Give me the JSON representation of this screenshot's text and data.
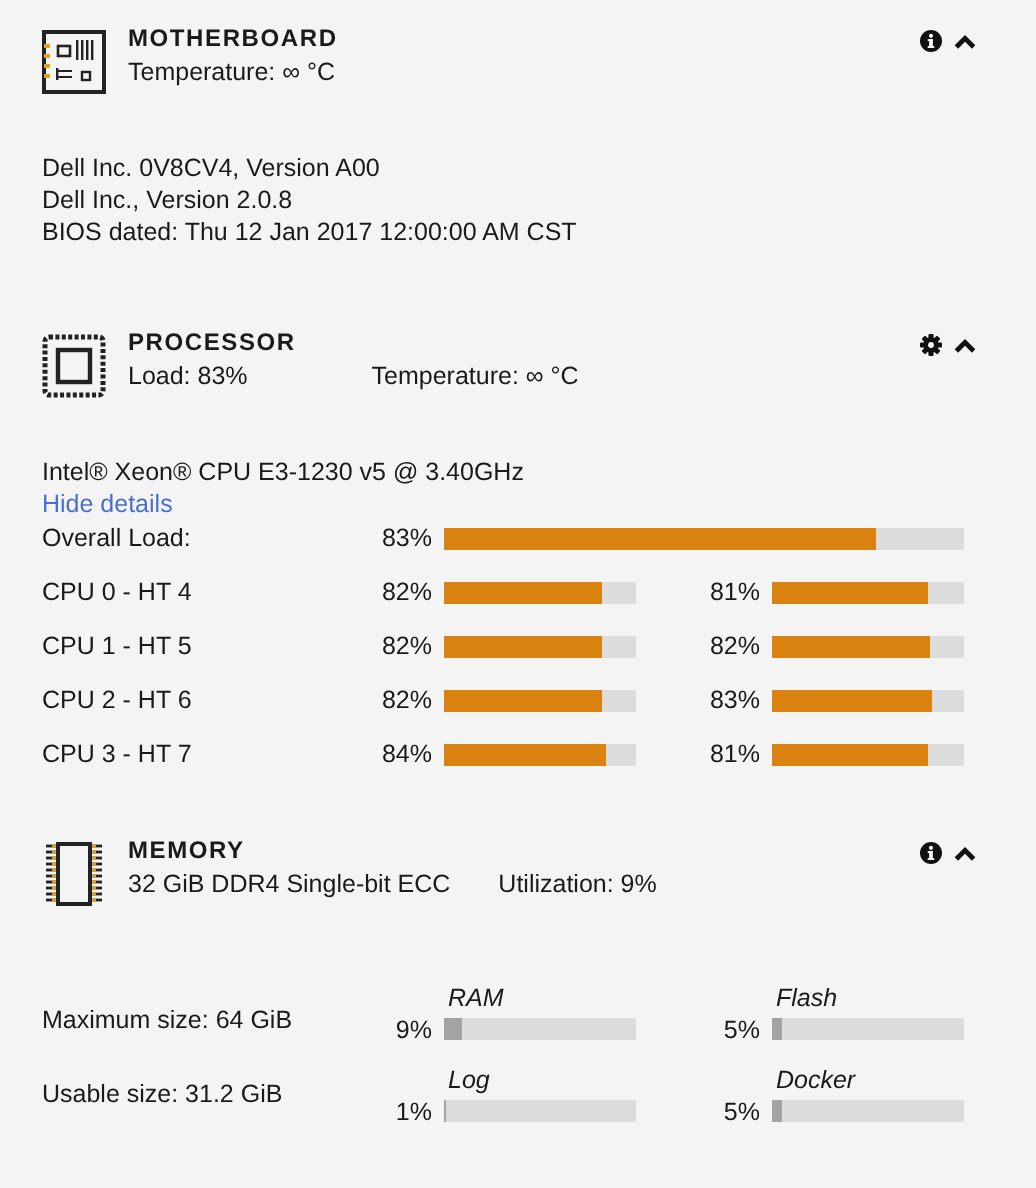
{
  "sections": [
    {
      "kind": "motherboard",
      "title": "MOTHERBOARD",
      "summary": [
        "Temperature: ∞ °C"
      ],
      "details": [
        "Dell Inc. 0V8CV4, Version A00",
        "Dell Inc., Version 2.0.8",
        "BIOS dated: Thu 12 Jan 2017 12:00:00 AM CST"
      ]
    },
    {
      "kind": "processor",
      "title": "PROCESSOR",
      "summary": [
        "Load: 83%",
        "Temperature: ∞ °C"
      ],
      "details": [
        "Intel® Xeon® CPU E3-1230 v5 @ 3.40GHz"
      ],
      "link": "Hide details",
      "overall": {
        "label": "Overall Load:",
        "reading": "83%",
        "level": 0.83
      },
      "cores": [
        {
          "label": "CPU 0 - HT 4",
          "threads": [
            {
              "reading": "82%",
              "level": 0.82
            },
            {
              "reading": "81%",
              "level": 0.81
            }
          ]
        },
        {
          "label": "CPU 1 - HT 5",
          "threads": [
            {
              "reading": "82%",
              "level": 0.82
            },
            {
              "reading": "82%",
              "level": 0.82
            }
          ]
        },
        {
          "label": "CPU 2 - HT 6",
          "threads": [
            {
              "reading": "82%",
              "level": 0.82
            },
            {
              "reading": "83%",
              "level": 0.83
            }
          ]
        },
        {
          "label": "CPU 3 - HT 7",
          "threads": [
            {
              "reading": "84%",
              "level": 0.84
            },
            {
              "reading": "81%",
              "level": 0.81
            }
          ]
        }
      ]
    },
    {
      "kind": "memory",
      "title": "MEMORY",
      "summary": [
        "32 GiB DDR4 Single-bit ECC",
        "Utilization: 9%"
      ],
      "rows": [
        {
          "label": "Maximum size: 64 GiB",
          "meters": [
            {
              "name": "RAM",
              "reading": "9%",
              "level": 0.09
            },
            {
              "name": "Flash",
              "reading": "5%",
              "level": 0.05
            }
          ]
        },
        {
          "label": "Usable size: 31.2 GiB",
          "meters": [
            {
              "name": "Log",
              "reading": "1%",
              "level": 0.01
            },
            {
              "name": "Docker",
              "reading": "5%",
              "level": 0.05
            }
          ]
        }
      ]
    }
  ]
}
